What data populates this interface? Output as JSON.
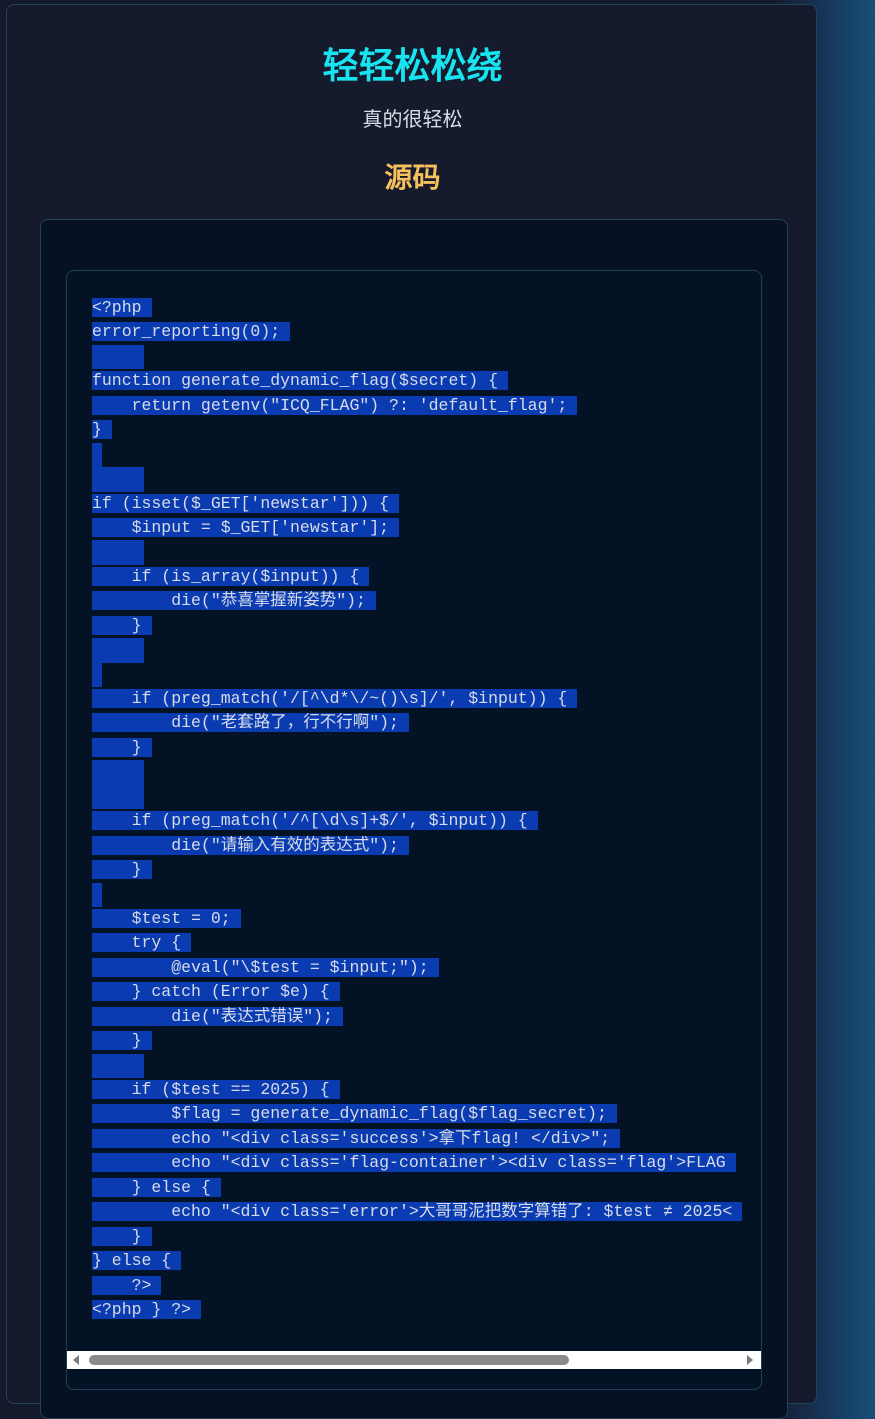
{
  "page": {
    "title": "轻轻松松绕",
    "subtitle": "真的很轻松",
    "section_title": "源码"
  },
  "code": {
    "lines": [
      "<?php",
      "error_reporting(0);",
      "",
      "function generate_dynamic_flag($secret) {",
      "    return getenv(\"ICQ_FLAG\") ?: 'default_flag';",
      "}",
      "",
      "",
      "if (isset($_GET['newstar'])) {",
      "    $input = $_GET['newstar'];",
      "",
      "    if (is_array($input)) {",
      "        die(\"恭喜掌握新姿势\");",
      "    }",
      "",
      "",
      "    if (preg_match('/[^\\d*\\/~()\\s]/', $input)) {",
      "        die(\"老套路了，行不行啊\");",
      "    }",
      "",
      "",
      "    if (preg_match('/^[\\d\\s]+$/', $input)) {",
      "        die(\"请输入有效的表达式\");",
      "    }",
      "",
      "    $test = 0;",
      "    try {",
      "        @eval(\"\\$test = $input;\");",
      "    } catch (Error $e) {",
      "        die(\"表达式错误\");",
      "    }",
      "",
      "    if ($test == 2025) {",
      "        $flag = generate_dynamic_flag($flag_secret);",
      "        echo \"<div class='success'>拿下flag! </div>\";",
      "        echo \"<div class='flag-container'><div class='flag'>FLAG",
      "    } else {",
      "        echo \"<div class='error'>大哥哥泥把数字算错了: $test ≠ 2025<",
      "    }",
      "} else {",
      "    ?>",
      "<?php } ?>"
    ]
  },
  "scrollbar": {
    "orientation": "horizontal",
    "visible_fraction": 0.72,
    "position": 0
  }
}
